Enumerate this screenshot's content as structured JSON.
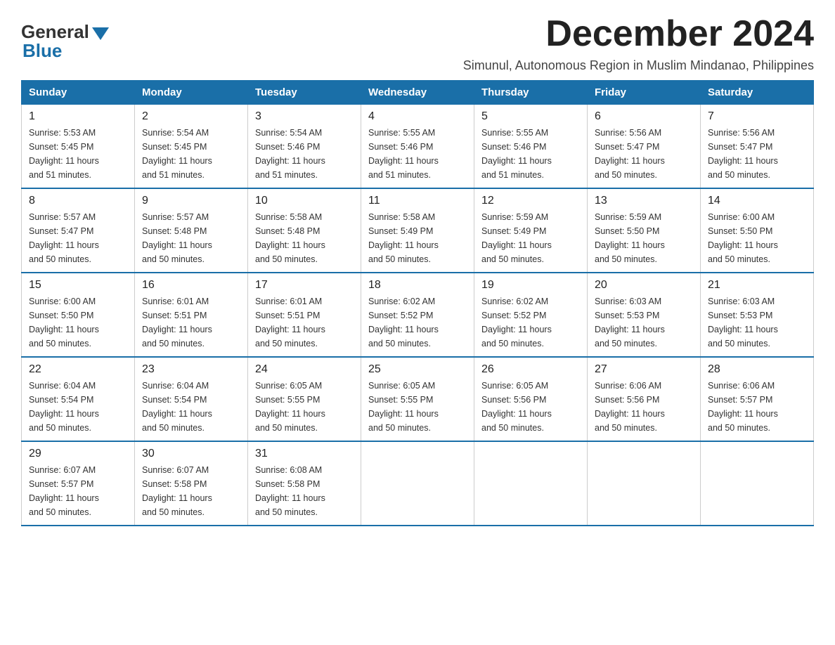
{
  "logo": {
    "general": "General",
    "blue": "Blue"
  },
  "title": "December 2024",
  "subtitle": "Simunul, Autonomous Region in Muslim Mindanao, Philippines",
  "days_of_week": [
    "Sunday",
    "Monday",
    "Tuesday",
    "Wednesday",
    "Thursday",
    "Friday",
    "Saturday"
  ],
  "weeks": [
    [
      {
        "day": "1",
        "sunrise": "5:53 AM",
        "sunset": "5:45 PM",
        "daylight": "11 hours and 51 minutes."
      },
      {
        "day": "2",
        "sunrise": "5:54 AM",
        "sunset": "5:45 PM",
        "daylight": "11 hours and 51 minutes."
      },
      {
        "day": "3",
        "sunrise": "5:54 AM",
        "sunset": "5:46 PM",
        "daylight": "11 hours and 51 minutes."
      },
      {
        "day": "4",
        "sunrise": "5:55 AM",
        "sunset": "5:46 PM",
        "daylight": "11 hours and 51 minutes."
      },
      {
        "day": "5",
        "sunrise": "5:55 AM",
        "sunset": "5:46 PM",
        "daylight": "11 hours and 51 minutes."
      },
      {
        "day": "6",
        "sunrise": "5:56 AM",
        "sunset": "5:47 PM",
        "daylight": "11 hours and 50 minutes."
      },
      {
        "day": "7",
        "sunrise": "5:56 AM",
        "sunset": "5:47 PM",
        "daylight": "11 hours and 50 minutes."
      }
    ],
    [
      {
        "day": "8",
        "sunrise": "5:57 AM",
        "sunset": "5:47 PM",
        "daylight": "11 hours and 50 minutes."
      },
      {
        "day": "9",
        "sunrise": "5:57 AM",
        "sunset": "5:48 PM",
        "daylight": "11 hours and 50 minutes."
      },
      {
        "day": "10",
        "sunrise": "5:58 AM",
        "sunset": "5:48 PM",
        "daylight": "11 hours and 50 minutes."
      },
      {
        "day": "11",
        "sunrise": "5:58 AM",
        "sunset": "5:49 PM",
        "daylight": "11 hours and 50 minutes."
      },
      {
        "day": "12",
        "sunrise": "5:59 AM",
        "sunset": "5:49 PM",
        "daylight": "11 hours and 50 minutes."
      },
      {
        "day": "13",
        "sunrise": "5:59 AM",
        "sunset": "5:50 PM",
        "daylight": "11 hours and 50 minutes."
      },
      {
        "day": "14",
        "sunrise": "6:00 AM",
        "sunset": "5:50 PM",
        "daylight": "11 hours and 50 minutes."
      }
    ],
    [
      {
        "day": "15",
        "sunrise": "6:00 AM",
        "sunset": "5:50 PM",
        "daylight": "11 hours and 50 minutes."
      },
      {
        "day": "16",
        "sunrise": "6:01 AM",
        "sunset": "5:51 PM",
        "daylight": "11 hours and 50 minutes."
      },
      {
        "day": "17",
        "sunrise": "6:01 AM",
        "sunset": "5:51 PM",
        "daylight": "11 hours and 50 minutes."
      },
      {
        "day": "18",
        "sunrise": "6:02 AM",
        "sunset": "5:52 PM",
        "daylight": "11 hours and 50 minutes."
      },
      {
        "day": "19",
        "sunrise": "6:02 AM",
        "sunset": "5:52 PM",
        "daylight": "11 hours and 50 minutes."
      },
      {
        "day": "20",
        "sunrise": "6:03 AM",
        "sunset": "5:53 PM",
        "daylight": "11 hours and 50 minutes."
      },
      {
        "day": "21",
        "sunrise": "6:03 AM",
        "sunset": "5:53 PM",
        "daylight": "11 hours and 50 minutes."
      }
    ],
    [
      {
        "day": "22",
        "sunrise": "6:04 AM",
        "sunset": "5:54 PM",
        "daylight": "11 hours and 50 minutes."
      },
      {
        "day": "23",
        "sunrise": "6:04 AM",
        "sunset": "5:54 PM",
        "daylight": "11 hours and 50 minutes."
      },
      {
        "day": "24",
        "sunrise": "6:05 AM",
        "sunset": "5:55 PM",
        "daylight": "11 hours and 50 minutes."
      },
      {
        "day": "25",
        "sunrise": "6:05 AM",
        "sunset": "5:55 PM",
        "daylight": "11 hours and 50 minutes."
      },
      {
        "day": "26",
        "sunrise": "6:05 AM",
        "sunset": "5:56 PM",
        "daylight": "11 hours and 50 minutes."
      },
      {
        "day": "27",
        "sunrise": "6:06 AM",
        "sunset": "5:56 PM",
        "daylight": "11 hours and 50 minutes."
      },
      {
        "day": "28",
        "sunrise": "6:06 AM",
        "sunset": "5:57 PM",
        "daylight": "11 hours and 50 minutes."
      }
    ],
    [
      {
        "day": "29",
        "sunrise": "6:07 AM",
        "sunset": "5:57 PM",
        "daylight": "11 hours and 50 minutes."
      },
      {
        "day": "30",
        "sunrise": "6:07 AM",
        "sunset": "5:58 PM",
        "daylight": "11 hours and 50 minutes."
      },
      {
        "day": "31",
        "sunrise": "6:08 AM",
        "sunset": "5:58 PM",
        "daylight": "11 hours and 50 minutes."
      },
      null,
      null,
      null,
      null
    ]
  ],
  "labels": {
    "sunrise": "Sunrise:",
    "sunset": "Sunset:",
    "daylight": "Daylight:"
  }
}
